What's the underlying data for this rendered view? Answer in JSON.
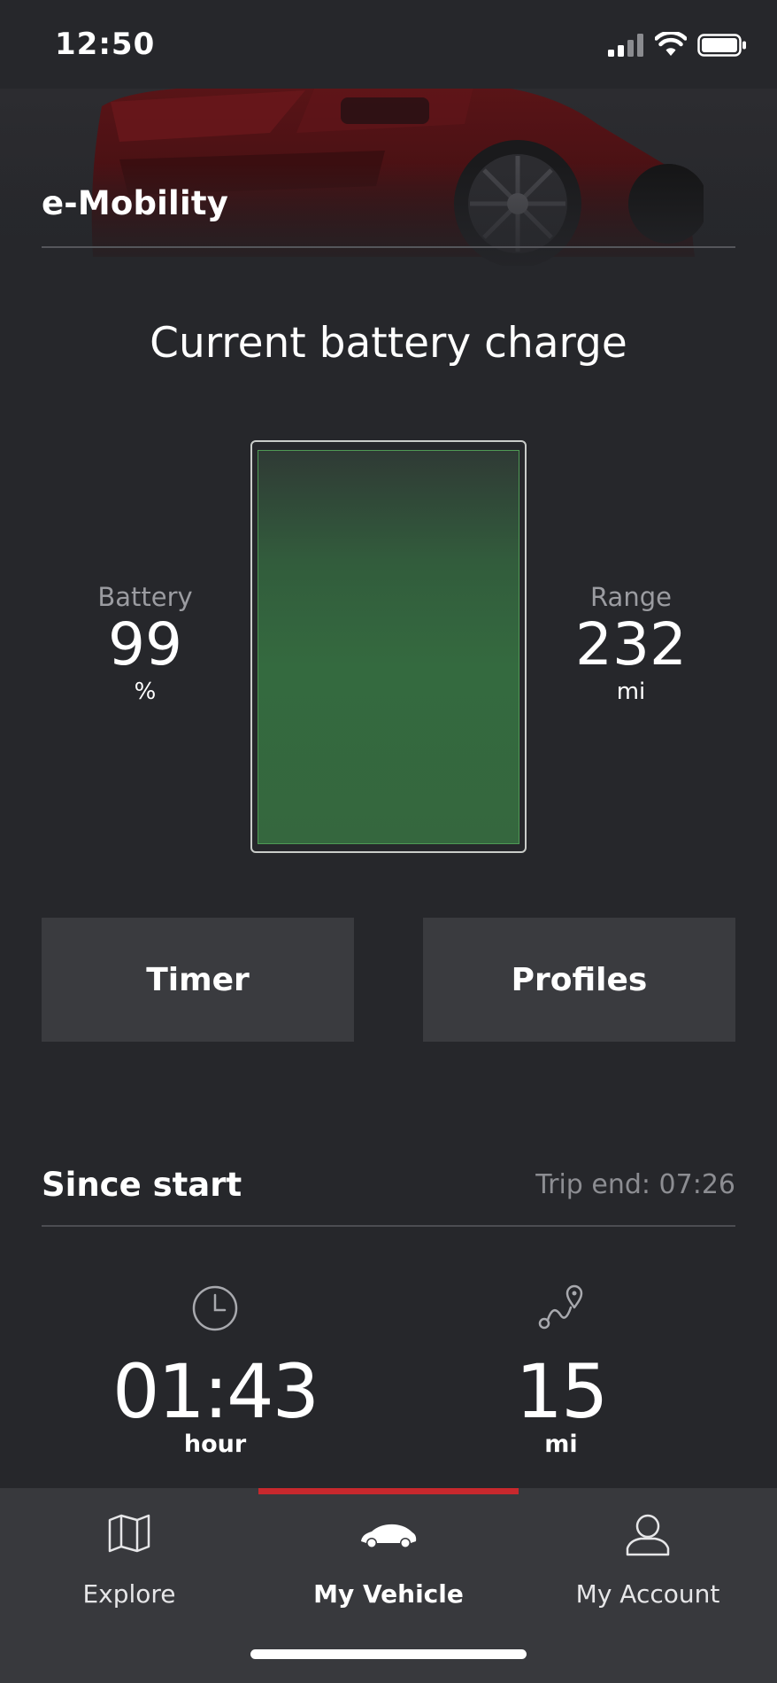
{
  "status_bar": {
    "time": "12:50",
    "icons": [
      "signal-icon",
      "wifi-icon",
      "battery-icon"
    ]
  },
  "header": {
    "title": "e-Mobility"
  },
  "battery": {
    "heading": "Current battery charge",
    "charge_label": "Battery",
    "charge_value": "99",
    "charge_unit": "%",
    "range_label": "Range",
    "range_value": "232",
    "range_unit": "mi",
    "fill_level_percent": 99,
    "fill_color": "#35673e"
  },
  "actions": {
    "timer_label": "Timer",
    "profiles_label": "Profiles"
  },
  "trip": {
    "title": "Since start",
    "trip_end": "Trip end: 07:26",
    "duration_value": "01:43",
    "duration_unit": "hour",
    "distance_value": "15",
    "distance_unit": "mi",
    "icons": [
      "clock-icon",
      "route-icon"
    ]
  },
  "nav": {
    "items": [
      {
        "label": "Explore",
        "icon": "map-icon",
        "active": false
      },
      {
        "label": "My Vehicle",
        "icon": "car-icon",
        "active": true
      },
      {
        "label": "My Account",
        "icon": "user-icon",
        "active": false
      }
    ],
    "active_color": "#c8282d"
  }
}
